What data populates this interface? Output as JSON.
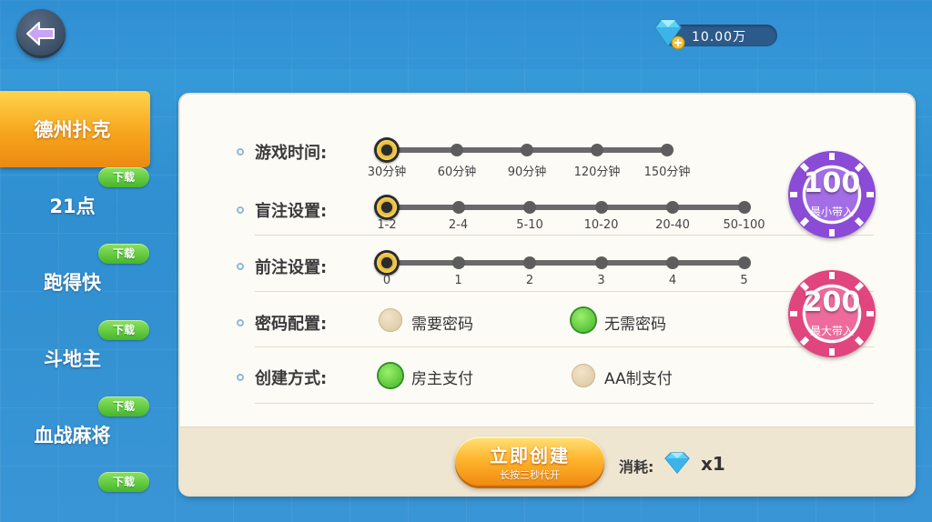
{
  "header": {
    "back_icon": "arrow-left-icon",
    "diamond_icon": "diamond-plus-icon",
    "diamonds": "10.00万"
  },
  "sidebar": {
    "tabs": [
      {
        "label": "德州扑克",
        "active": true
      },
      {
        "label": "21点",
        "active": false
      },
      {
        "label": "跑得快",
        "active": false
      },
      {
        "label": "斗地主",
        "active": false
      },
      {
        "label": "血战麻将",
        "active": false
      }
    ],
    "download_label": "下载"
  },
  "settings": {
    "game_time": {
      "label": "游戏时间:",
      "options": [
        "30分钟",
        "60分钟",
        "90分钟",
        "120分钟",
        "150分钟"
      ],
      "selected_index": 0
    },
    "blind": {
      "label": "盲注设置:",
      "options": [
        "1-2",
        "2-4",
        "5-10",
        "10-20",
        "20-40",
        "50-100"
      ],
      "selected_index": 0
    },
    "ante": {
      "label": "前注设置:",
      "options": [
        "0",
        "1",
        "2",
        "3",
        "4",
        "5"
      ],
      "selected_index": 0
    },
    "password": {
      "label": "密码配置:",
      "options": [
        "需要密码",
        "无需密码"
      ],
      "selected_index": 1
    },
    "create_mode": {
      "label": "创建方式:",
      "options": [
        "房主支付",
        "AA制支付"
      ],
      "selected_index": 0
    }
  },
  "chips": {
    "min": {
      "value": "100",
      "label": "最小带入",
      "color": "#8a4bd6"
    },
    "max": {
      "value": "200",
      "label": "最大带入",
      "color": "#e0457d"
    }
  },
  "footer": {
    "create_label": "立即创建",
    "create_sub": "长按三秒代开",
    "cost_label": "消耗:",
    "cost_icon": "diamond-icon",
    "cost_value": "x1"
  },
  "colors": {
    "accent_orange": "#f6a51d",
    "accent_green": "#45b62b",
    "panel": "#fdfbf6"
  }
}
